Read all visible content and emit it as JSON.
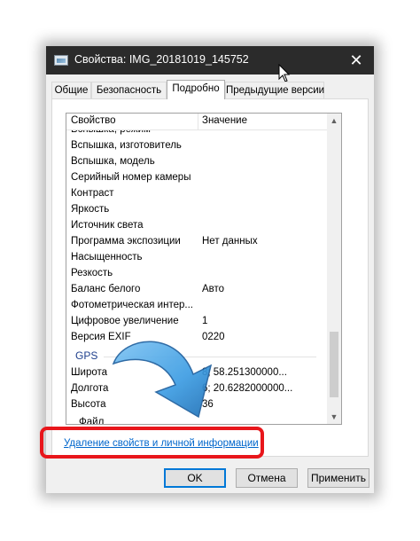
{
  "window": {
    "title": "Свойства: IMG_20181019_145752",
    "close_glyph": "✕"
  },
  "tabs": [
    {
      "label": "Общие"
    },
    {
      "label": "Безопасность"
    },
    {
      "label": "Подробно",
      "active": true
    },
    {
      "label": "Предыдущие версии"
    }
  ],
  "list": {
    "header": {
      "property": "Свойство",
      "value": "Значение"
    },
    "partial_top_row": "Вспышка, режим",
    "rows": [
      {
        "property": "Вспышка, изготовитель",
        "value": ""
      },
      {
        "property": "Вспышка, модель",
        "value": ""
      },
      {
        "property": "Серийный номер камеры",
        "value": ""
      },
      {
        "property": "Контраст",
        "value": ""
      },
      {
        "property": "Яркость",
        "value": ""
      },
      {
        "property": "Источник света",
        "value": ""
      },
      {
        "property": "Программа экспозиции",
        "value": "Нет данных"
      },
      {
        "property": "Насыщенность",
        "value": ""
      },
      {
        "property": "Резкость",
        "value": ""
      },
      {
        "property": "Баланс белого",
        "value": "Авто"
      },
      {
        "property": "Фотометрическая интер...",
        "value": ""
      },
      {
        "property": "Цифровое увеличение",
        "value": "1"
      },
      {
        "property": "Версия EXIF",
        "value": "0220"
      }
    ],
    "gps_group": "GPS",
    "gps_rows": [
      {
        "property": "Широта",
        "value": "8; 58.251300000..."
      },
      {
        "property": "Долгота",
        "value": "6; 20.6282000000..."
      },
      {
        "property": "Высота",
        "value": "36"
      }
    ],
    "partial_bottom_row": "Файл"
  },
  "link": {
    "label": "Удаление свойств и личной информации"
  },
  "buttons": {
    "ok": "OK",
    "cancel": "Отмена",
    "apply": "Применить"
  },
  "scrollbar": {
    "up": "▲",
    "down": "▼"
  },
  "colors": {
    "titlebar": "#2b2b2b",
    "link": "#0066cc",
    "highlight": "#e8161b",
    "arrow": "#3d9de3",
    "default_button_border": "#0078d7"
  },
  "icons": {
    "window": "image-file-icon",
    "close": "close-icon",
    "cursor": "mouse-pointer-icon",
    "arrow": "curved-arrow-icon"
  }
}
